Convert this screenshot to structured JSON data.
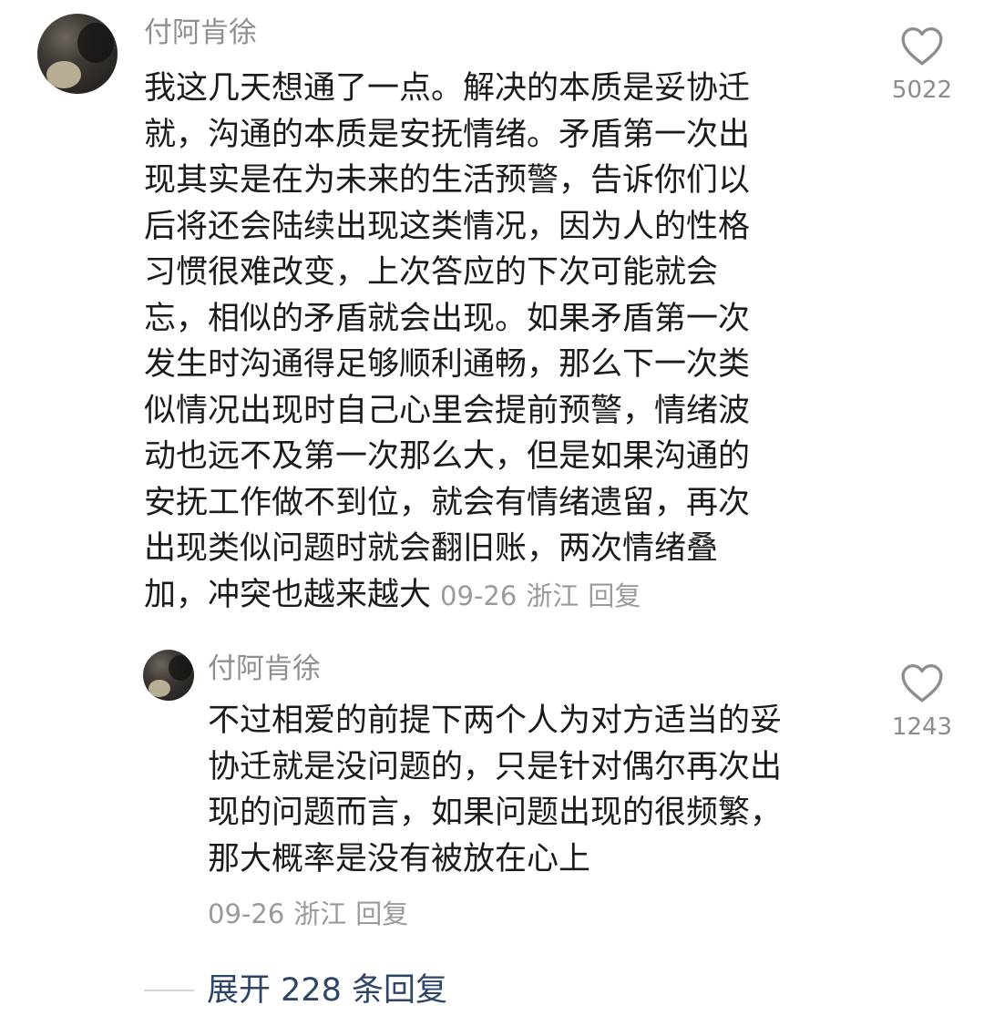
{
  "comment": {
    "username": "付阿肯徐",
    "lines": [
      "我这几天想通了一点。解决的本质是妥协迁",
      "就，沟通的本质是安抚情绪。矛盾第一次出",
      "现其实是在为未来的生活预警，告诉你们以",
      "后将还会陆续出现这类情况，因为人的性格",
      "习惯很难改变，上次答应的下次可能就会",
      "忘，相似的矛盾就会出现。如果矛盾第一次",
      "发生时沟通得足够顺利通畅，那么下一次类",
      "似情况出现时自己心里会提前预警，情绪波",
      "动也远不及第一次那么大，但是如果沟通的",
      "安抚工作做不到位，就会有情绪遗留，再次",
      "出现类似问题时就会翻旧账，两次情绪叠"
    ],
    "last_line": "加，冲突也越来越大",
    "date": "09-26",
    "location": "浙江",
    "reply_label": "回复",
    "like_count": "5022"
  },
  "reply": {
    "username": "付阿肯徐",
    "lines": [
      "不过相爱的前提下两个人为对方适当的妥",
      "协迁就是没问题的，只是针对偶尔再次出",
      "现的问题而言，如果问题出现的很频繁，",
      "那大概率是没有被放在心上"
    ],
    "date": "09-26",
    "location": "浙江",
    "reply_label": "回复",
    "like_count": "1243"
  },
  "expand": {
    "label": "展开 228 条回复"
  },
  "icons": {
    "like": "heart-outline-icon"
  },
  "colors": {
    "text": "#1b1b1b",
    "meta": "#9a9a9a",
    "link": "#2d4667"
  }
}
